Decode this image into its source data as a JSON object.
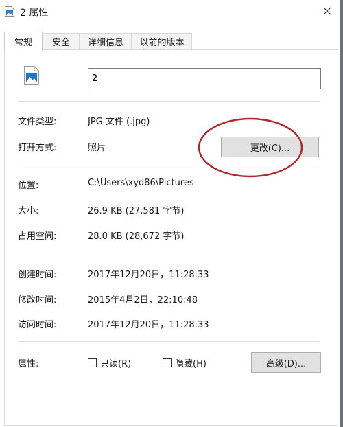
{
  "window": {
    "title": "2 属性"
  },
  "tabs": [
    {
      "label": "常规",
      "active": true
    },
    {
      "label": "安全",
      "active": false
    },
    {
      "label": "详细信息",
      "active": false
    },
    {
      "label": "以前的版本",
      "active": false
    }
  ],
  "general": {
    "file_name": "2",
    "file_type_label": "文件类型:",
    "file_type_value": "JPG 文件 (.jpg)",
    "opens_with_label": "打开方式:",
    "opens_with_value": "照片",
    "change_button": "更改(C)...",
    "location_label": "位置:",
    "location_value": "C:\\Users\\xyd86\\Pictures",
    "size_label": "大小:",
    "size_value": "26.9 KB (27,581 字节)",
    "size_on_disk_label": "占用空间:",
    "size_on_disk_value": "28.0 KB (28,672 字节)",
    "created_label": "创建时间:",
    "created_value": "2017年12月20日，11:28:33",
    "modified_label": "修改时间:",
    "modified_value": "2015年4月2日，22:10:48",
    "accessed_label": "访问时间:",
    "accessed_value": "2017年12月20日，11:28:33",
    "attributes_label": "属性:",
    "readonly_label": "只读(R)",
    "readonly_checked": false,
    "hidden_label": "隐藏(H)",
    "hidden_checked": false,
    "advanced_button": "高级(D)..."
  },
  "icons": {
    "app": "image-file-icon",
    "file": "image-file-icon",
    "close": "close-icon"
  },
  "colors": {
    "annotation": "#b3262a",
    "input_border": "#7a7a7a",
    "button_bg": "#e1e1e1"
  }
}
